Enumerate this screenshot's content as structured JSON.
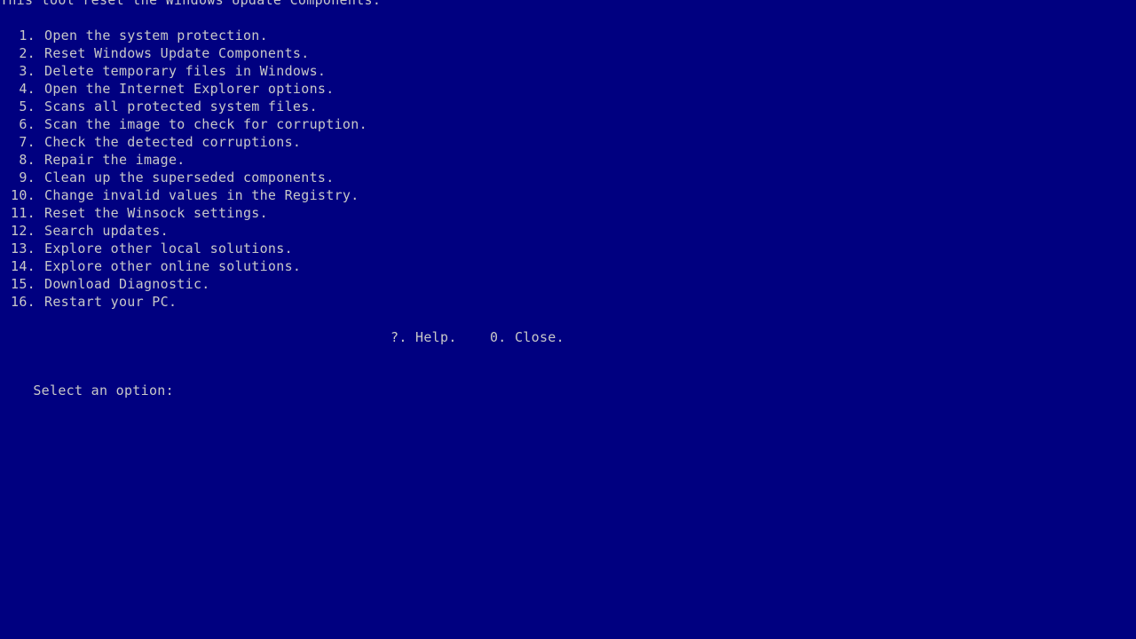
{
  "console": {
    "background_color": "#000080",
    "text_color": "#c8c8c8",
    "header": "This tool reset the Windows Update Components.",
    "menu_items": [
      {
        "number": "1.",
        "label": "Open the system protection."
      },
      {
        "number": "2.",
        "label": "Reset Windows Update Components."
      },
      {
        "number": "3.",
        "label": "Delete temporary files in Windows."
      },
      {
        "number": "4.",
        "label": "Open the Internet Explorer options."
      },
      {
        "number": "5.",
        "label": "Scans all protected system files."
      },
      {
        "number": "6.",
        "label": "Scan the image to check for corruption."
      },
      {
        "number": "7.",
        "label": "Check the detected corruptions."
      },
      {
        "number": "8.",
        "label": "Repair the image."
      },
      {
        "number": "9.",
        "label": "Clean up the superseded components."
      },
      {
        "number": "10.",
        "label": "Change invalid values in the Registry."
      },
      {
        "number": "11.",
        "label": "Reset the Winsock settings."
      },
      {
        "number": "12.",
        "label": "Search updates."
      },
      {
        "number": "13.",
        "label": "Explore other local solutions."
      },
      {
        "number": "14.",
        "label": "Explore other online solutions."
      },
      {
        "number": "15.",
        "label": "Download Diagnostic."
      },
      {
        "number": "16.",
        "label": "Restart your PC."
      }
    ],
    "footer": {
      "help_key": "?.",
      "help_label": "Help.",
      "close_key": "0.",
      "close_label": "Close.",
      "full_text": "?. Help.    0. Close."
    },
    "prompt": {
      "text": "Select an option:",
      "input_value": ""
    }
  }
}
